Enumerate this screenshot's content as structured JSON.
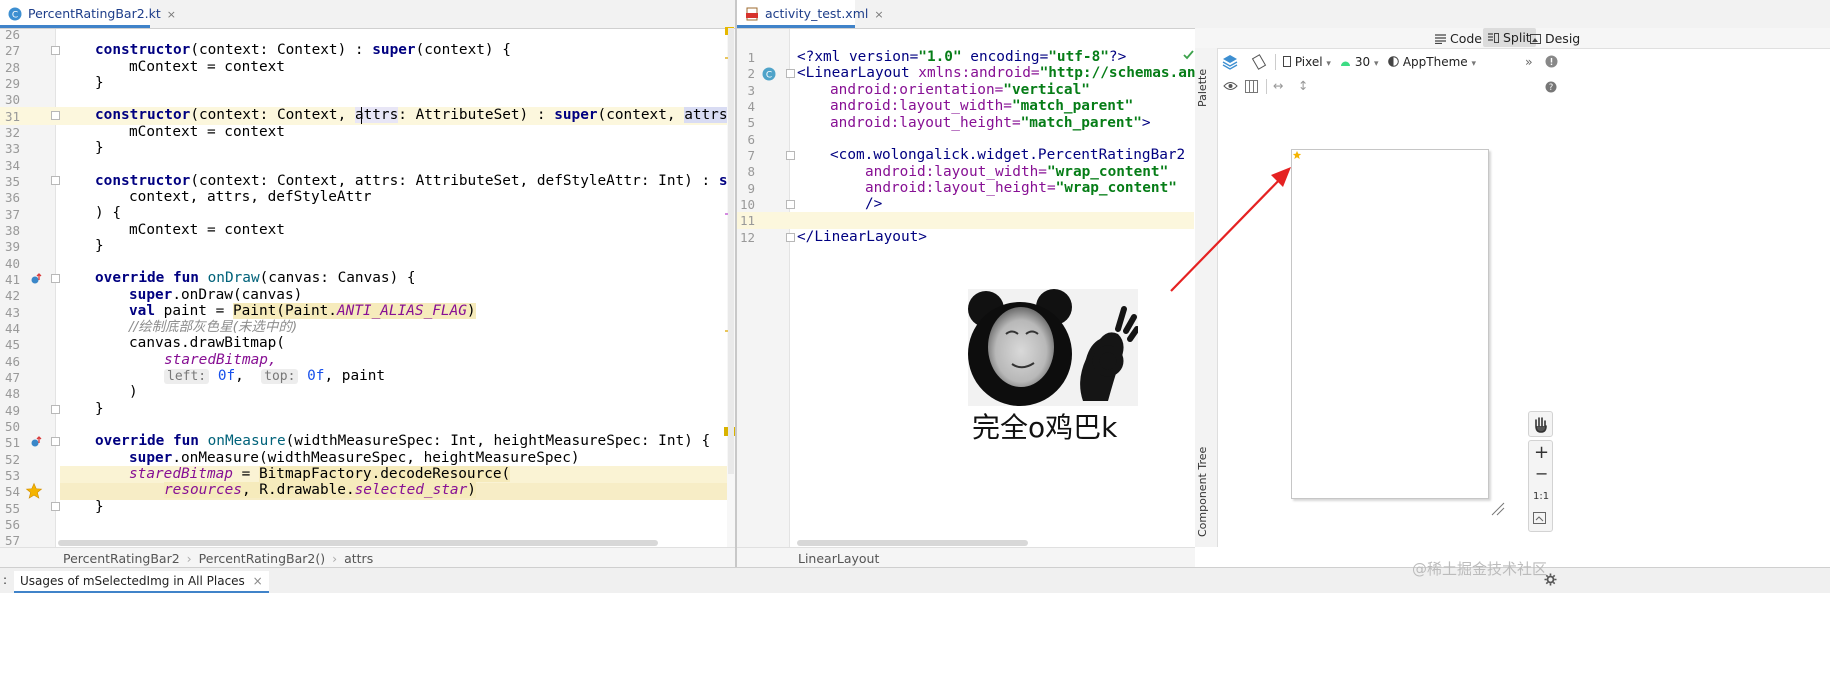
{
  "left_tab": {
    "title": "PercentRatingBar2.kt",
    "close": "×"
  },
  "right_tab": {
    "title": "activity_test.xml",
    "close": "×"
  },
  "left_lines": [
    "26",
    "27",
    "28",
    "29",
    "30",
    "31",
    "32",
    "33",
    "34",
    "35",
    "36",
    "37",
    "38",
    "39",
    "40",
    "41",
    "42",
    "43",
    "44",
    "45",
    "46",
    "47",
    "48",
    "49",
    "50",
    "51",
    "52",
    "53",
    "54",
    "55",
    "56",
    "57"
  ],
  "right_lines": [
    "1",
    "2",
    "3",
    "4",
    "5",
    "6",
    "7",
    "8",
    "9",
    "10",
    "11",
    "12"
  ],
  "kt": {
    "l27a": "constructor",
    "l27b": "(context: Context) : ",
    "l27c": "super",
    "l27d": "(context) {",
    "l28": "mContext = context",
    "l29": "}",
    "l31a": "constructor",
    "l31b": "(context: Context, ",
    "l31c": "attrs",
    "l31d": ": AttributeSet) : ",
    "l31e": "super",
    "l31f": "(context, ",
    "l31g": "attrs",
    "l31h": ")",
    "l32": "mContext = context",
    "l33": "}",
    "l35a": "constructor",
    "l35b": "(context: Context, attrs: AttributeSet, defStyleAttr: Int) : ",
    "l35c": "sup",
    "l36": "context, attrs, defStyleAttr",
    "l37": ") {",
    "l38": "mContext = context",
    "l39": "}",
    "l41a": "override fun ",
    "l41b": "onDraw",
    "l41c": "(canvas: Canvas) {",
    "l42a": "super",
    "l42b": ".onDraw(canvas)",
    "l43a": "val ",
    "l43b": "paint = ",
    "l43c": "Paint(Paint.",
    "l43d": "ANTI_ALIAS_FLAG",
    "l43e": ")",
    "l44": "//绘制底部灰色星(未选中的)",
    "l45": "canvas.drawBitmap(",
    "l46": "staredBitmap,",
    "l47a": "left:",
    "l47b": "0f",
    "l47c": ",  ",
    "l47d": "top:",
    "l47e": "0f",
    "l47f": ", paint",
    "l48": ")",
    "l49": "}",
    "l51a": "override fun ",
    "l51b": "onMeasure",
    "l51c": "(widthMeasureSpec: Int, heightMeasureSpec: Int) {",
    "l52a": "super",
    "l52b": ".onMeasure(widthMeasureSpec, heightMeasureSpec)",
    "l53a": "staredBitmap",
    "l53b": " = ",
    "l53c": "BitmapFactory.decodeResource(",
    "l54a": "resources",
    "l54b": ", R.drawable.",
    "l54c": "selected_star",
    "l54d": ")",
    "l55": "}"
  },
  "xml": {
    "l1a": "<?xml version=",
    "l1b": "\"1.0\"",
    "l1c": " encoding=",
    "l1d": "\"utf-8\"",
    "l1e": "?>",
    "l2a": "<LinearLayout ",
    "l2b": "xmlns:android=",
    "l2c": "\"http://schemas.and",
    "l3a": "android:orientation=",
    "l3b": "\"vertical\"",
    "l4a": "android:layout_width=",
    "l4b": "\"match_parent\"",
    "l5a": "android:layout_height=",
    "l5b": "\"match_parent\"",
    "l5c": ">",
    "l7": "<com.wolongalick.widget.PercentRatingBar2",
    "l8a": "android:layout_width=",
    "l8b": "\"wrap_content\"",
    "l9a": "android:layout_height=",
    "l9b": "\"wrap_content\"",
    "l10": "/>",
    "l12": "</LinearLayout>"
  },
  "left_breadcrumb": [
    "PercentRatingBar2",
    "PercentRatingBar2()",
    "attrs"
  ],
  "right_breadcrumb": "LinearLayout",
  "view_modes": {
    "code": "Code",
    "split": "Split",
    "design": "Desig"
  },
  "design_toolbar": {
    "device": "Pixel",
    "api": "30",
    "theme": "AppTheme"
  },
  "side_labels": {
    "palette": "Palette",
    "component_tree": "Component Tree"
  },
  "zoom": {
    "plus": "+",
    "minus": "−",
    "one_to_one": "1:1"
  },
  "meme_caption": "完全o鸡巴k",
  "bottom_panel": {
    "usages": "Usages of mSelectedImg in All Places",
    "close": "×",
    "prefix": ":"
  },
  "watermark": "@稀土掘金技术社区",
  "colors": {
    "accent": "#4083c9",
    "arrow": "#e52222",
    "star": "#f5b400",
    "highlight": "#fcf7dd"
  }
}
